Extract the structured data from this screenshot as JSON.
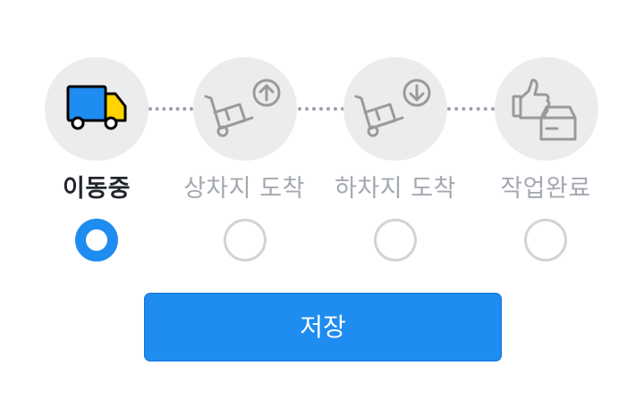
{
  "steps": [
    {
      "label": "이동중",
      "icon": "truck-icon",
      "state": "active",
      "selected": true
    },
    {
      "label": "상차지 도착",
      "icon": "hand-truck-upload-icon",
      "state": "inactive",
      "selected": false
    },
    {
      "label": "하차지 도착",
      "icon": "hand-truck-download-icon",
      "state": "inactive",
      "selected": false
    },
    {
      "label": "작업완료",
      "icon": "thumbs-up-box-icon",
      "state": "inactive",
      "selected": false
    }
  ],
  "save_button": {
    "label": "저장"
  },
  "colors": {
    "accent": "#1e8cf0",
    "truck_body": "#1e8cf0",
    "truck_cab": "#ffd400",
    "icon_gray": "#9a9a9a",
    "circle_bg": "#ececec",
    "label_active": "#23262d",
    "label_inactive": "#a4a8b1",
    "radio_border": "#d3d3d3",
    "connector": "#9aa1ae"
  }
}
